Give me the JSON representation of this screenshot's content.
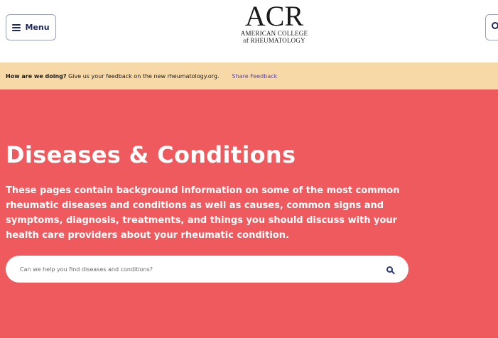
{
  "header": {
    "menu_label": "Menu",
    "logo": {
      "acr": "ACR",
      "line1": "AMERICAN COLLEGE",
      "line2": "of RHEUMATOLOGY"
    }
  },
  "feedback_banner": {
    "question": "How are we doing?",
    "message": " Give us your feedback on the new rheumatology.org.",
    "link_label": "Share Feedback"
  },
  "hero": {
    "title": "Diseases & Conditions",
    "description": "These pages contain background information on some of the most common rheumatic diseases and conditions as well as causes, common signs and symptoms, diagnosis, treatments, and things you should discuss with your health care providers about your rheumatic condition.",
    "search_placeholder": "Can we help you find diseases and conditions?"
  },
  "colors": {
    "hero_background": "#ef5a5f",
    "banner_background": "#f7d9a8",
    "link": "#5b3fb0",
    "navy": "#1f2a5a"
  },
  "icons": [
    "hamburger-icon",
    "search-icon"
  ]
}
